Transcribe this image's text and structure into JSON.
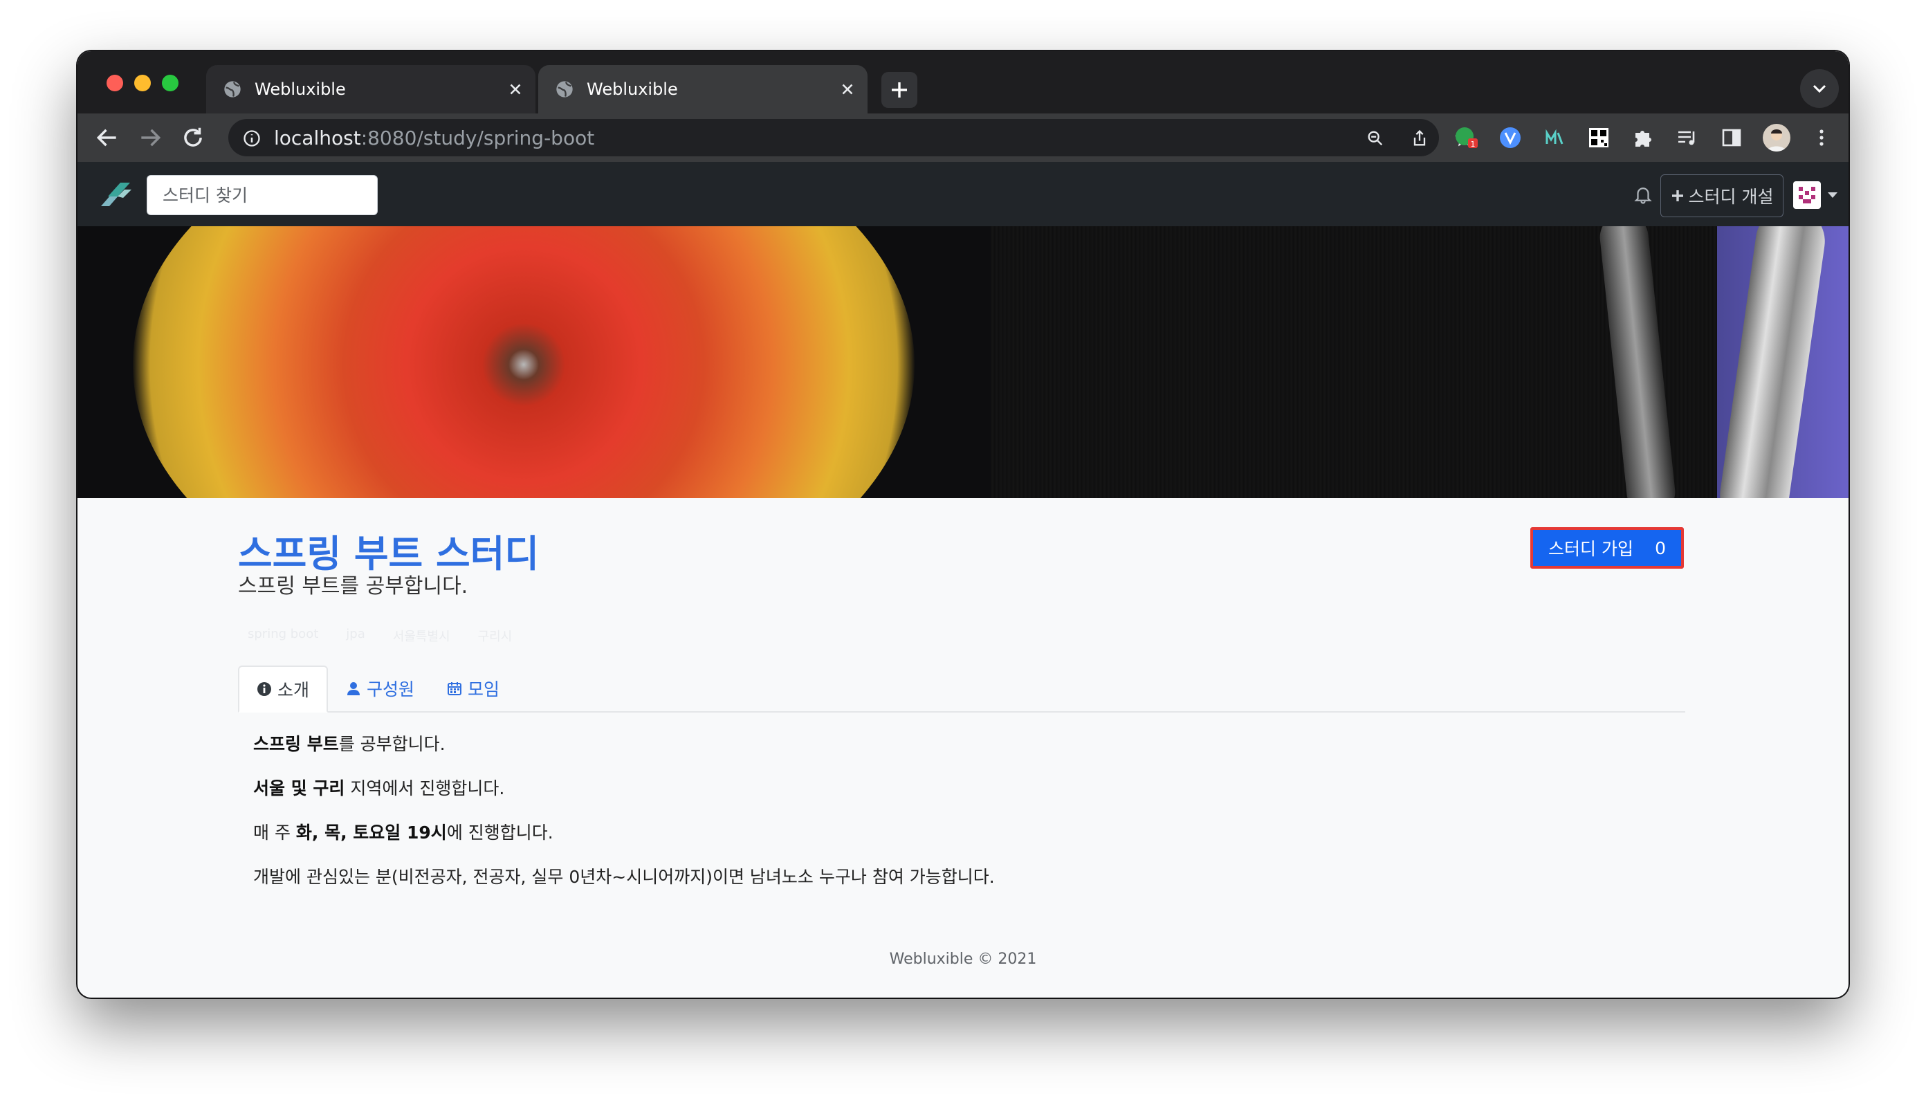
{
  "browser": {
    "tabs": [
      {
        "title": "Webluxible"
      },
      {
        "title": "Webluxible"
      }
    ],
    "url": {
      "host": "localhost",
      "rest": ":8080/study/spring-boot"
    },
    "extension_badge": "1"
  },
  "navbar": {
    "search_placeholder": "스터디 찾기",
    "open_study_label": "스터디 개설"
  },
  "study": {
    "title": "스프링 부트 스터디",
    "short_description": "스프링 부트를 공부합니다.",
    "join_label": "스터디 가입",
    "member_count": "0",
    "tags": [
      "spring boot",
      "jpa",
      "서울특별시",
      "구리시"
    ]
  },
  "tabs": [
    {
      "label": "소개"
    },
    {
      "label": "구성원"
    },
    {
      "label": "모임"
    }
  ],
  "content": {
    "line1": {
      "bold": "스프링 부트",
      "rest": "를 공부합니다."
    },
    "line2": {
      "bold": "서울 및 구리",
      "rest": " 지역에서 진행합니다."
    },
    "line3": {
      "pre": "매 주 ",
      "bold": "화, 목, 토요일 19시",
      "rest": "에 진행합니다."
    },
    "line4": "개발에 관심있는 분(비전공자, 전공자, 실무 0년차~시니어까지)이면 남녀노소 누구나 참여 가능합니다."
  },
  "footer": "Webluxible © 2021"
}
